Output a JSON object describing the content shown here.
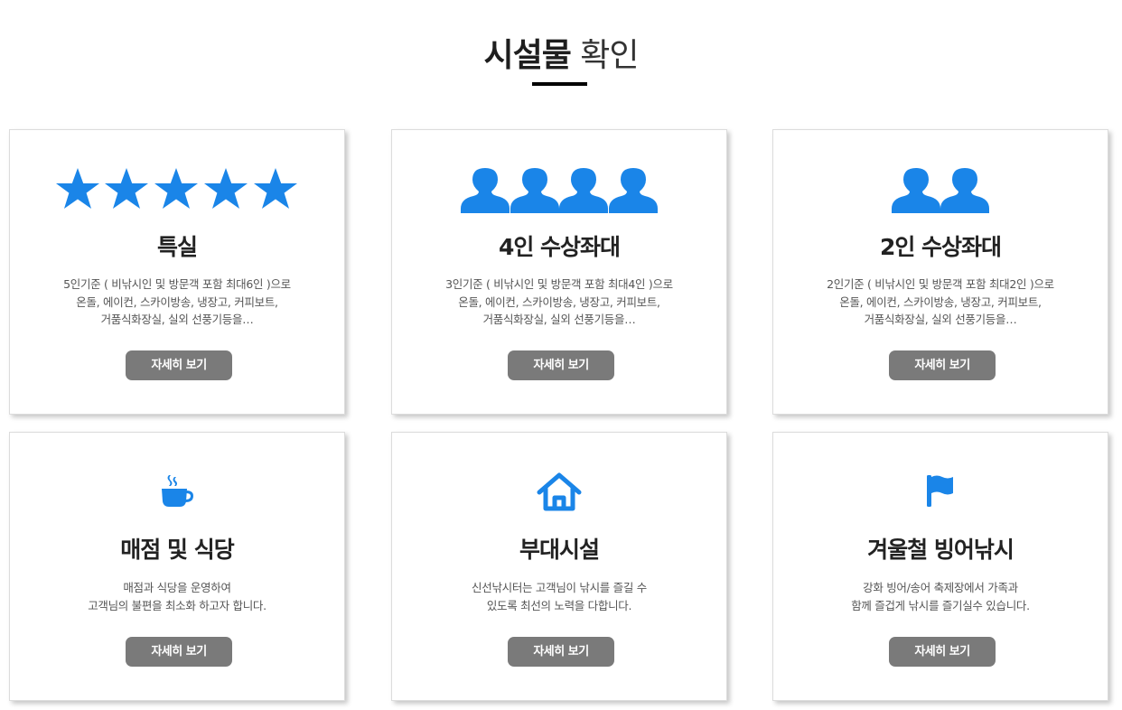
{
  "heading": {
    "bold": "시설물",
    "light": "확인"
  },
  "accent_color": "#1a85e8",
  "button_color": "#7a7a7a",
  "cards": [
    {
      "icon": "star-icon",
      "icon_count": 5,
      "title": "특실",
      "desc": [
        "5인기준 ( 비낚시인 및 방문객 포함 최대6인 )으로",
        "온돌, 에이컨, 스카이방송, 냉장고, 커피보트,",
        "거품식화장실, 실외 선풍기등을…"
      ],
      "button": "자세히 보기"
    },
    {
      "icon": "person-icon",
      "icon_count": 4,
      "title": "4인 수상좌대",
      "desc": [
        "3인기준 ( 비낚시인 및 방문객 포함 최대4인 )으로",
        "온돌, 에이컨, 스카이방송, 냉장고, 커피보트,",
        "거품식화장실, 실외 선풍기등을…"
      ],
      "button": "자세히 보기"
    },
    {
      "icon": "person-icon",
      "icon_count": 2,
      "title": "2인 수상좌대",
      "desc": [
        "2인기준 ( 비낚시인 및 방문객 포함 최대2인 )으로",
        "온돌, 에이컨, 스카이방송, 냉장고, 커피보트,",
        "거품식화장실, 실외 선풍기등을…"
      ],
      "button": "자세히 보기"
    },
    {
      "icon": "coffee-cup-icon",
      "icon_count": 1,
      "title": "매점 및 식당",
      "desc": [
        "매점과 식당을 운영하여",
        "고객님의 불편을 최소화 하고자 합니다."
      ],
      "button": "자세히 보기"
    },
    {
      "icon": "home-icon",
      "icon_count": 1,
      "title": "부대시설",
      "desc": [
        "신선낚시터는 고객님이 낚시를 즐길 수",
        "있도록 최선의 노력을 다합니다."
      ],
      "button": "자세히 보기"
    },
    {
      "icon": "flag-icon",
      "icon_count": 1,
      "title": "겨울철 빙어낚시",
      "desc": [
        "강화 빙어/송어 축제장에서 가족과",
        "함께 즐겁게 낚시를 즐기실수 있습니다."
      ],
      "button": "자세히 보기"
    }
  ]
}
